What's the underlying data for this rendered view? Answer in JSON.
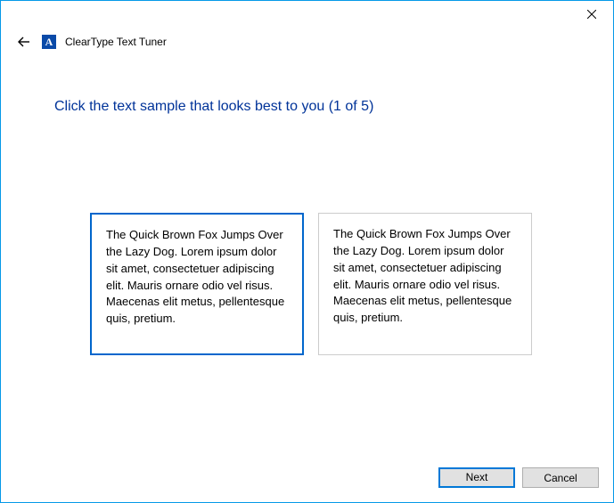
{
  "window": {
    "close_label": ""
  },
  "header": {
    "app_title": "ClearType Text Tuner"
  },
  "main": {
    "heading": "Click the text sample that looks best to you (1 of 5)",
    "samples": [
      {
        "selected": true,
        "text": "The Quick Brown Fox Jumps Over the Lazy Dog. Lorem ipsum dolor sit amet, consectetuer adipiscing elit. Mauris ornare odio vel risus. Maecenas elit metus, pellentesque quis, pretium."
      },
      {
        "selected": false,
        "text": "The Quick Brown Fox Jumps Over the Lazy Dog. Lorem ipsum dolor sit amet, consectetuer adipiscing elit. Mauris ornare odio vel risus. Maecenas elit metus, pellentesque quis, pretium."
      }
    ]
  },
  "footer": {
    "next_label": "Next",
    "cancel_label": "Cancel"
  }
}
